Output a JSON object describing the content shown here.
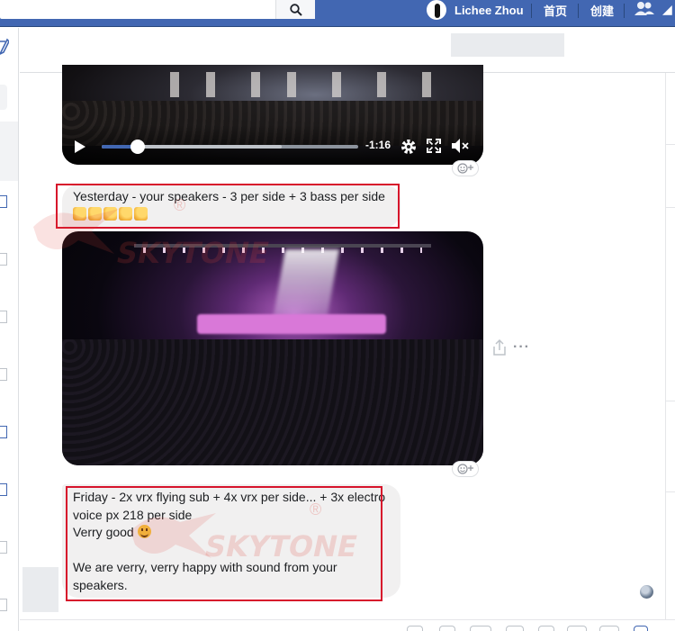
{
  "topbar": {
    "profile_name": "Lichee Zhou",
    "nav_home": "首页",
    "nav_create": "创建"
  },
  "video1": {
    "time_remaining": "-1:16",
    "progress_played": 0.14,
    "progress_buffered": 0.7
  },
  "messages": [
    {
      "text": "Yesterday - your speakers - 3 per side + 3 bass per side",
      "emoji_count": 5
    },
    {
      "lines": [
        "Friday - 2x vrx flying sub + 4x vrx per side... + 3x electro voice px 218 per side",
        "Verry good",
        "",
        "We are verry, verry happy with sound from your speakers."
      ]
    }
  ],
  "watermark": {
    "brand": "SKYTONE",
    "registered": "®"
  },
  "colors": {
    "brand_blue": "#4267b2",
    "bubble_gray": "#f1f0f0",
    "highlight_red": "#d7142b"
  },
  "icons": [
    "search-icon",
    "friends-icon",
    "compose-icon",
    "play-icon",
    "settings-icon",
    "fullscreen-icon",
    "mute-icon",
    "add-reaction-icon",
    "share-icon",
    "more-icon"
  ]
}
